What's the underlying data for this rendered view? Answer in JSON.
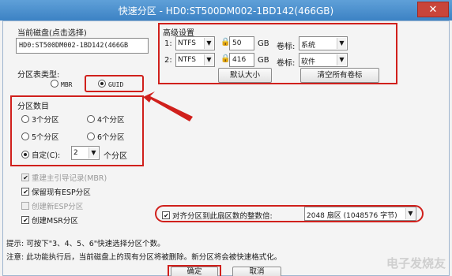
{
  "window": {
    "title": "快速分区 - HD0:ST500DM002-1BD142(466GB)",
    "close_glyph": "✕"
  },
  "current_disk": {
    "label": "当前磁盘(点击选择)",
    "value": "HD0:ST500DM002-1BD142(466GB"
  },
  "partition_table": {
    "label": "分区表类型:",
    "options": [
      {
        "label": "MBR",
        "selected": false
      },
      {
        "label": "GUID",
        "selected": true
      }
    ]
  },
  "partition_count": {
    "label": "分区数目",
    "options": [
      "3个分区",
      "4个分区",
      "5个分区",
      "6个分区"
    ],
    "custom_label": "自定(C):",
    "custom_value": "2",
    "custom_suffix": "个分区"
  },
  "options": [
    {
      "label": "重建主引导记录(MBR)",
      "checked": true,
      "disabled": true
    },
    {
      "label": "保留现有ESP分区",
      "checked": true,
      "disabled": false
    },
    {
      "label": "创建新ESP分区",
      "checked": false,
      "disabled": true
    },
    {
      "label": "创建MSR分区",
      "checked": true,
      "disabled": false
    }
  ],
  "advanced": {
    "label": "高级设置",
    "rows": [
      {
        "index": "1:",
        "fs": "NTFS",
        "size": "50",
        "unit": "GB",
        "vol_label": "卷标:",
        "vol_value": "系统"
      },
      {
        "index": "2:",
        "fs": "NTFS",
        "size": "416",
        "unit": "GB",
        "vol_label": "卷标:",
        "vol_value": "软件"
      }
    ],
    "default_size_btn": "默认大小",
    "clear_labels_btn": "清空所有卷标"
  },
  "align": {
    "label": "对齐分区到此扇区数的整数倍:",
    "value": "2048 扇区 (1048576 字节)",
    "checked": true
  },
  "tips": {
    "line1": "提示: 可按下\"3、4、5、6\"快速选择分区个数。",
    "line2": "注意: 此功能执行后，当前磁盘上的现有分区将被删除。新分区将会被快速格式化。"
  },
  "buttons": {
    "ok": "确定",
    "cancel": "取消"
  },
  "watermark": "电子发烧友",
  "colors": {
    "title_bar": "#3c82c4",
    "highlight": "#d0201c",
    "close": "#c9453a"
  }
}
